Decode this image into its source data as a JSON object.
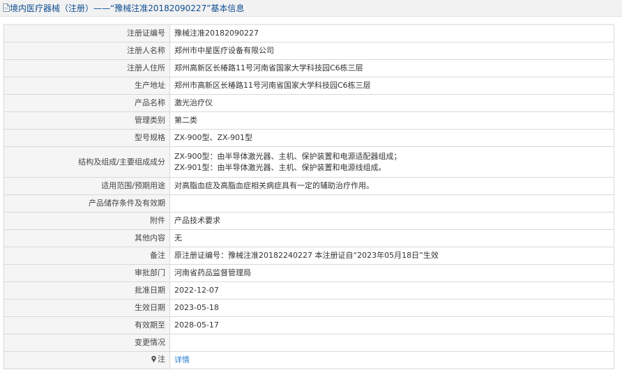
{
  "header": {
    "title": "境内医疗器械（注册）——“豫械注准20182090227”基本信息"
  },
  "rows": [
    {
      "label": "注册证编号",
      "value": "豫械注准20182090227"
    },
    {
      "label": "注册人名称",
      "value": "郑州市中星医疗设备有限公司"
    },
    {
      "label": "注册人住所",
      "value": "郑州高新区长椿路11号河南省国家大学科技园C6栋三层"
    },
    {
      "label": "生产地址",
      "value": "郑州市高新区长椿路11号河南省国家大学科技园C6栋三层"
    },
    {
      "label": "产品名称",
      "value": "激光治疗仪"
    },
    {
      "label": "管理类别",
      "value": "第二类"
    },
    {
      "label": "型号规格",
      "value": "ZX-900型、ZX-901型"
    },
    {
      "label": "结构及组成/主要组成成分",
      "value_line1": "ZX-900型：由半导体激光器、主机、保护装置和电源适配器组成；",
      "value_line2": "ZX-901型：由半导体激光器、主机、保护装置和电源线组成。"
    },
    {
      "label": "适用范围/预期用途",
      "value": "对高脂血症及高脂血症相关病症具有一定的辅助治疗作用。"
    },
    {
      "label": "产品储存条件及有效期",
      "value": ""
    },
    {
      "label": "附件",
      "value": "产品技术要求"
    },
    {
      "label": "其他内容",
      "value": "无"
    },
    {
      "label": "备注",
      "value": "原注册证编号：豫械注准20182240227 本注册证自“2023年05月18日”生效"
    },
    {
      "label": "审批部门",
      "value": "河南省药品监督管理局"
    },
    {
      "label": "批准日期",
      "value": "2022-12-07"
    },
    {
      "label": "生效日期",
      "value": "2023-05-18"
    },
    {
      "label": "有效期至",
      "value": "2028-05-17"
    },
    {
      "label": "变更情况",
      "value": ""
    },
    {
      "label": "注",
      "value": "详情"
    }
  ],
  "colors": {
    "title": "#0e4d91",
    "link": "#2a7bd2",
    "label_bg": "#f5f5f5",
    "border": "#d9d9d9"
  },
  "icons": {
    "header": "document-icon",
    "note": "pin-icon"
  }
}
